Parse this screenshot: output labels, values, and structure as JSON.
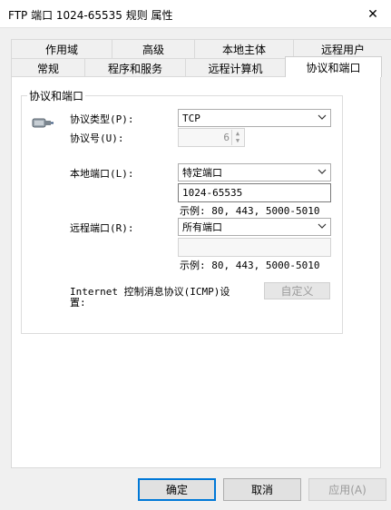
{
  "window": {
    "title": "FTP 端口 1024-65535 规则 属性",
    "close_glyph": "✕"
  },
  "tabs_back": [
    "作用域",
    "高级",
    "本地主体",
    "远程用户"
  ],
  "tabs_front": [
    "常规",
    "程序和服务",
    "远程计算机",
    "协议和端口"
  ],
  "group": {
    "title": "协议和端口",
    "protocol_type_label": "协议类型(P):",
    "protocol_type_value": "TCP",
    "protocol_number_label": "协议号(U):",
    "protocol_number_value": "6",
    "local_port_label": "本地端口(L):",
    "local_port_value": "特定端口",
    "local_port_text": "1024-65535",
    "local_example": "示例: 80, 443, 5000-5010",
    "remote_port_label": "远程端口(R):",
    "remote_port_value": "所有端口",
    "remote_port_text": "",
    "remote_example": "示例: 80, 443, 5000-5010",
    "icmp_label_line1": "Internet 控制消息协议(ICMP)设",
    "icmp_label_line2": "置:",
    "customize_button": "自定义"
  },
  "footer": {
    "ok": "确定",
    "cancel": "取消",
    "apply": "应用(A)"
  },
  "colors": {
    "accent": "#0078d7"
  }
}
